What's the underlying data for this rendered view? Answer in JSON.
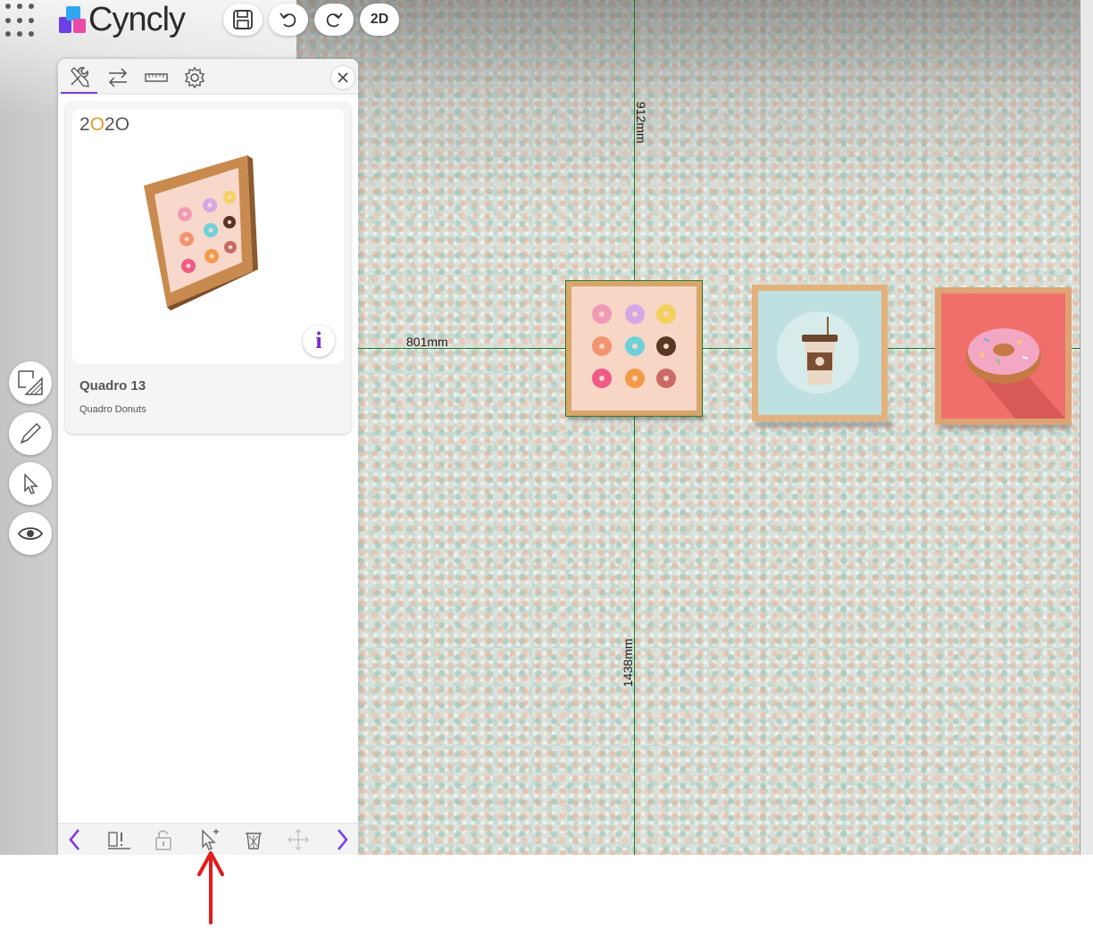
{
  "app": {
    "brand_name": "Cyncly",
    "view_mode_label": "2D"
  },
  "toolbar": {
    "save": "save-icon",
    "undo": "undo-icon",
    "redo": "redo-icon"
  },
  "panel": {
    "tabs": [
      "tools-icon",
      "swap-icon",
      "ruler-icon",
      "gear-icon"
    ],
    "active_tab": 0,
    "product": {
      "brand_logo": "2020",
      "name": "Quadro 13",
      "description": "Quadro Donuts",
      "info_label": "i"
    },
    "bottom_actions": [
      "previous",
      "align-bottom",
      "lock",
      "add-select",
      "delete",
      "move",
      "next"
    ]
  },
  "side_tools": [
    "floor-plan-icon",
    "pencil-icon",
    "pointer-icon",
    "eye-icon"
  ],
  "dimensions": {
    "top": "912mm",
    "left": "801mm",
    "bottom": "1438mm"
  },
  "colors": {
    "accent": "#7b3fe4",
    "guide": "#1d7a1d",
    "annotation": "#e31b1b"
  }
}
